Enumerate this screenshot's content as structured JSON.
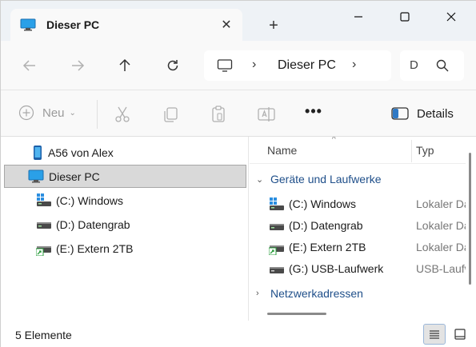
{
  "window": {
    "tab_title": "Dieser PC",
    "tab_close": "✕",
    "new_tab": "+",
    "controls": {
      "minimize": "—",
      "maximize": "☐",
      "close": "✕"
    }
  },
  "nav": {
    "address_separator": "›",
    "address_text": "Dieser PC",
    "search_text": "D"
  },
  "commands": {
    "new_label": "Neu",
    "new_chevron": "⌄",
    "more": "•••",
    "details_label": "Details"
  },
  "sidebar": {
    "items": [
      {
        "label": "A56 von Alex",
        "icon": "phone-icon"
      },
      {
        "label": "Dieser PC",
        "icon": "monitor-icon"
      },
      {
        "label": "(C:) Windows",
        "icon": "windows-drive-icon"
      },
      {
        "label": "(D:) Datengrab",
        "icon": "drive-icon"
      },
      {
        "label": "(E:) Extern 2TB",
        "icon": "shared-drive-icon"
      }
    ]
  },
  "content": {
    "col_name": "Name",
    "col_type": "Typ",
    "sort_indicator": "^",
    "group_drives": "Geräte und Laufwerke",
    "group_network": "Netzwerkadressen",
    "group_expanded_chevron": "⌄",
    "group_collapsed_chevron": "›",
    "rows": [
      {
        "name": "(C:) Windows",
        "type": "Lokaler Datenträger",
        "icon": "windows-drive-icon"
      },
      {
        "name": "(D:) Datengrab",
        "type": "Lokaler Datenträger",
        "icon": "drive-icon"
      },
      {
        "name": "(E:) Extern 2TB",
        "type": "Lokaler Datenträger",
        "icon": "shared-drive-icon"
      },
      {
        "name": "(G:) USB-Laufwerk",
        "type": "USB-Laufwerk",
        "icon": "usb-drive-icon"
      }
    ]
  },
  "status": {
    "item_count": "5 Elemente"
  },
  "colors": {
    "accent": "#0067c0",
    "group_header": "#1f4f8a",
    "selection": "#d9d9d9"
  }
}
